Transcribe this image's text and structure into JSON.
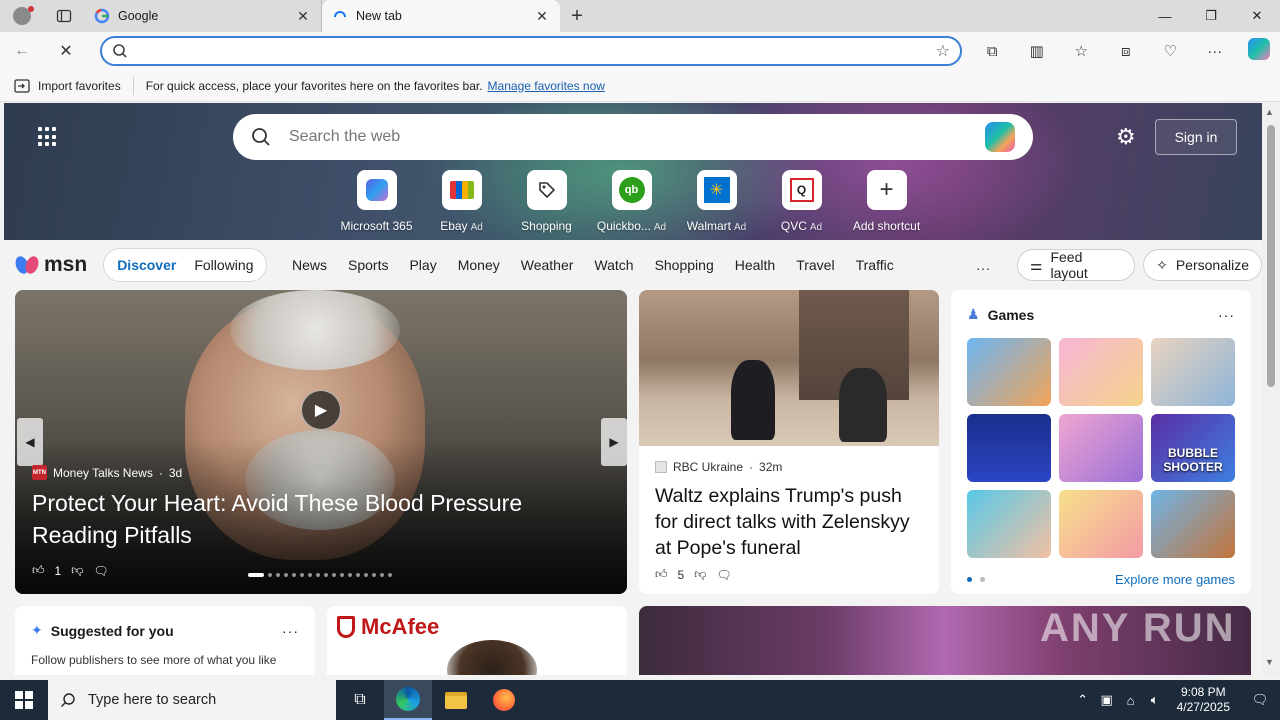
{
  "browser": {
    "tabs": [
      {
        "title": "Google",
        "icon": "google-icon",
        "active": false
      },
      {
        "title": "New tab",
        "icon": "loading-icon",
        "active": true
      }
    ],
    "omnibox": {
      "value": "",
      "placeholder": ""
    },
    "favorites_bar": {
      "import_label": "Import favorites",
      "message": "For quick access, place your favorites here on the favorites bar.",
      "link": "Manage favorites now"
    }
  },
  "newtab": {
    "search_placeholder": "Search the web",
    "signin": "Sign in",
    "shortcuts": [
      {
        "label": "Microsoft 365",
        "ad": ""
      },
      {
        "label": "Ebay",
        "ad": "Ad"
      },
      {
        "label": "Shopping",
        "ad": ""
      },
      {
        "label": "Quickbo...",
        "ad": "Ad"
      },
      {
        "label": "Walmart",
        "ad": "Ad"
      },
      {
        "label": "QVC",
        "ad": "Ad"
      },
      {
        "label": "Add shortcut",
        "ad": ""
      }
    ]
  },
  "msn": {
    "logo": "msn",
    "pill_tabs": [
      "Discover",
      "Following"
    ],
    "categories": [
      "News",
      "Sports",
      "Play",
      "Money",
      "Weather",
      "Watch",
      "Shopping",
      "Health",
      "Travel",
      "Traffic"
    ],
    "more": "...",
    "feed_layout": "Feed layout",
    "personalize": "Personalize"
  },
  "hero": {
    "source": "Money Talks News",
    "source_logo": "MTN",
    "age": "3d",
    "headline": "Protect Your Heart: Avoid These Blood Pressure Reading Pitfalls",
    "likes": "1"
  },
  "news2": {
    "source": "RBC Ukraine",
    "age": "32m",
    "headline": "Waltz explains Trump's push for direct talks with Zelenskyy at Pope's funeral",
    "likes": "5"
  },
  "games": {
    "title": "Games",
    "explore": "Explore more games",
    "tiles": [
      "",
      "",
      "",
      "",
      "",
      "BUBBLE SHOOTER",
      "",
      "",
      ""
    ]
  },
  "suggested": {
    "title": "Suggested for you",
    "text": "Follow publishers to see more of what you like"
  },
  "ad": {
    "brand": "McAfee"
  },
  "watermark": "ANY RUN",
  "taskbar": {
    "search_placeholder": "Type here to search",
    "time": "9:08 PM",
    "date": "4/27/2025"
  }
}
